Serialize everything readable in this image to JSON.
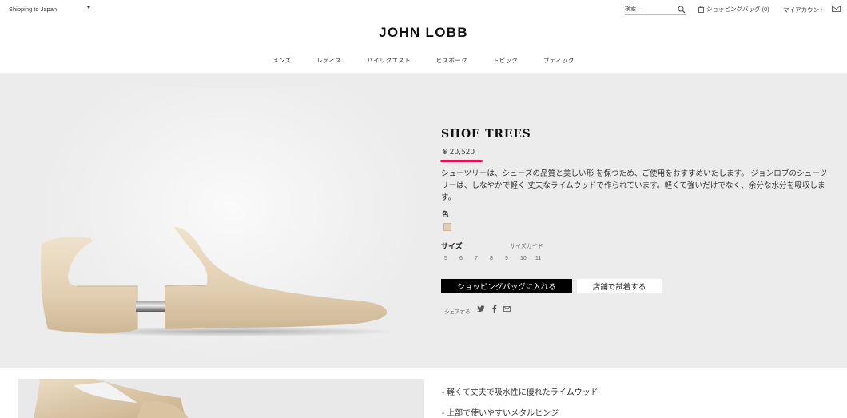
{
  "topbar": {
    "shipping": "Shipping to Japan",
    "search_placeholder": "検索...",
    "bag_label": "ショッピングバッグ (0)",
    "account_label": "マイアカウント"
  },
  "brand": {
    "logo": "JOHN LOBB"
  },
  "nav": [
    "メンズ",
    "レディス",
    "バイリクエスト",
    "ビスポーク",
    "トピック",
    "ブティック"
  ],
  "product": {
    "title": "SHOE TREES",
    "price": "¥ 20,520",
    "description": "シューツリーは、シューズの品質と美しい形 を保つため、ご使用をおすすめいたします。 ジョンロブのシューツリーは、しなやかで軽く 丈夫なライムウッドで作られています。軽くて強いだけでなく、余分な水分を吸収します。",
    "color_label": "色",
    "swatch_color": "#e3cdb3",
    "size_label": "サイズ",
    "size_guide": "サイズガイド",
    "sizes": [
      "5",
      "6",
      "7",
      "8",
      "9",
      "10",
      "11"
    ],
    "add_to_bag": "ショッピングバッグに入れる",
    "try_in_store": "店舗で試着する",
    "share_label": "シェアする",
    "accent_color": "#e3145c"
  },
  "features": [
    "-  軽くて丈夫で吸水性に優れたライムウッド",
    "-  上部で使いやすいメタルヒンジ"
  ]
}
